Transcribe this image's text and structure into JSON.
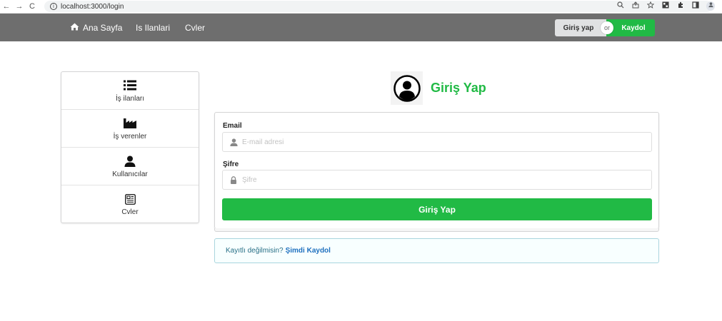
{
  "browser": {
    "url": "localhost:3000/login",
    "back_icon": "←",
    "forward_icon": "→",
    "reload_icon": "C",
    "info_icon": "i"
  },
  "navbar": {
    "home_label": "Ana Sayfa",
    "jobs_label": "Is Ilanlari",
    "cv_label": "Cvler",
    "login_label": "Giriş yap",
    "or_label": "or",
    "register_label": "Kaydol"
  },
  "sidebar": {
    "items": [
      {
        "label": "İş ilanları",
        "icon": "list-icon"
      },
      {
        "label": "İş verenler",
        "icon": "industry-icon"
      },
      {
        "label": "Kullanıcılar",
        "icon": "user-icon"
      },
      {
        "label": "Cvler",
        "icon": "newspaper-icon"
      }
    ]
  },
  "login": {
    "title": "Giriş Yap",
    "email_label": "Email",
    "email_placeholder": "E-mail adresi",
    "password_label": "Şifre",
    "password_placeholder": "Şifre",
    "submit_label": "Giriş Yap"
  },
  "message": {
    "text": "Kayıtlı değilmisin?",
    "link": "Şimdi Kaydol"
  },
  "colors": {
    "brand_green": "#21ba45",
    "navbar_gray": "#6e6e6e",
    "info_blue": "#276f86",
    "link_blue": "#1e70bf"
  }
}
